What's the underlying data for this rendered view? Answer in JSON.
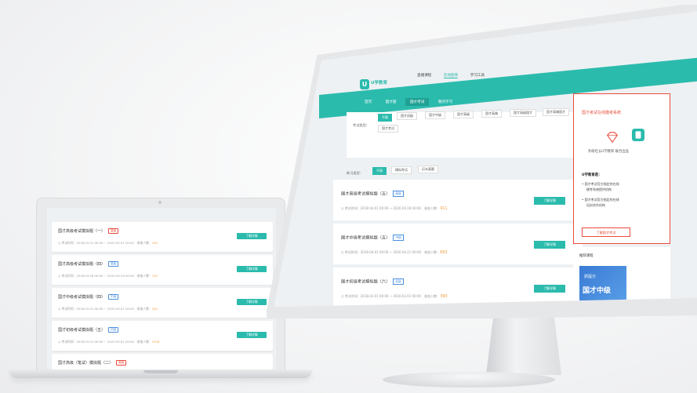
{
  "laptop": {
    "cards": [
      {
        "title": "国才高级考试模拟题（一）",
        "tag": "高级",
        "tag_color": "red",
        "meta": "考试时间：2018.03.01 00:00 ~ 2020.03.01 00:00",
        "count_label": "参加人数：",
        "count": "190",
        "button": "了解详情"
      },
      {
        "title": "国才高级考试模拟题（四）",
        "tag": "高级",
        "tag_color": "blue",
        "meta": "考试时间：2018.03.28 00:00 ~ 2020.03.29 00:00",
        "count_label": "参加人数：",
        "count": "150",
        "button": "了解详情"
      },
      {
        "title": "国才中级考试模拟题（四）",
        "tag": "中级",
        "tag_color": "blue",
        "meta": "考试时间：2018.03.01 00:00 ~ 2020.03.01 00:00",
        "count_label": "参加人数：",
        "count": "340",
        "button": "了解详情"
      },
      {
        "title": "国才初级考试模拟题（五）",
        "tag": "初级",
        "tag_color": "blue",
        "meta": "考试时间：2018.03.01 00:00 ~ 2020.03.01 00:00",
        "count_label": "参加人数：",
        "count": "1939",
        "button": "了解详情"
      },
      {
        "title": "国才高级（笔试）模拟题（二）",
        "tag": "高级",
        "tag_color": "red",
        "meta": "",
        "count_label": "",
        "count": "",
        "button": ""
      }
    ]
  },
  "monitor": {
    "logo_mark": "U",
    "logo_text": "U学教育",
    "topnav": [
      "直播课程",
      "在线题库",
      "学习工具"
    ],
    "tabs": [
      "首页",
      "国才题",
      "国才考试",
      "我的学习"
    ],
    "filter": {
      "exam_type_label": "考试类型：",
      "exam_types": [
        "不限",
        "国才初级",
        "国才中级",
        "国才高级",
        "国才高端",
        "国才高级国才",
        "国才高端国才",
        "国才考试"
      ],
      "practice_label": "练习类型：",
      "practice_types": [
        "不限",
        "模拟考试",
        "历年真题"
      ]
    },
    "cards": [
      {
        "title": "国才高级考试模拟题（五）",
        "tag": "高级",
        "meta": "考试时间：2018.04.01 00:00 ~ 2020.04.18 00:00",
        "count_label": "参加人数：",
        "count": "411",
        "button": "了解详情"
      },
      {
        "title": "国才中级考试模拟题（五）",
        "tag": "中级",
        "meta": "考试时间：2018.04.01 00:00 ~ 2020.04.21 00:00",
        "count_label": "参加人数：",
        "count": "893",
        "button": "了解详情"
      },
      {
        "title": "国才初级考试模拟题（六）",
        "tag": "初级",
        "meta": "考试时间：2018.03.01 00:00 ~ 2020.03.01 00:00",
        "count_label": "参加人数：",
        "count": "390",
        "button": "了解详情"
      }
    ],
    "side": {
      "heading": "国才考试在线模考系统",
      "subtitle": "外研社＆U学教育 联合出品",
      "bold": "U学教育是：",
      "items": [
        "国才考试官方指定的在线",
        "模考系统提供机构",
        "国才考试官方指定的在线",
        "培训合作机构"
      ],
      "button": "了解国才考试"
    },
    "side2": {
      "heading": "推荐课程",
      "badge": "抓提分",
      "course": "国才中级"
    }
  },
  "colors": {
    "accent": "#2bbbad",
    "red": "#e74c3c",
    "count": "#f0a040"
  }
}
